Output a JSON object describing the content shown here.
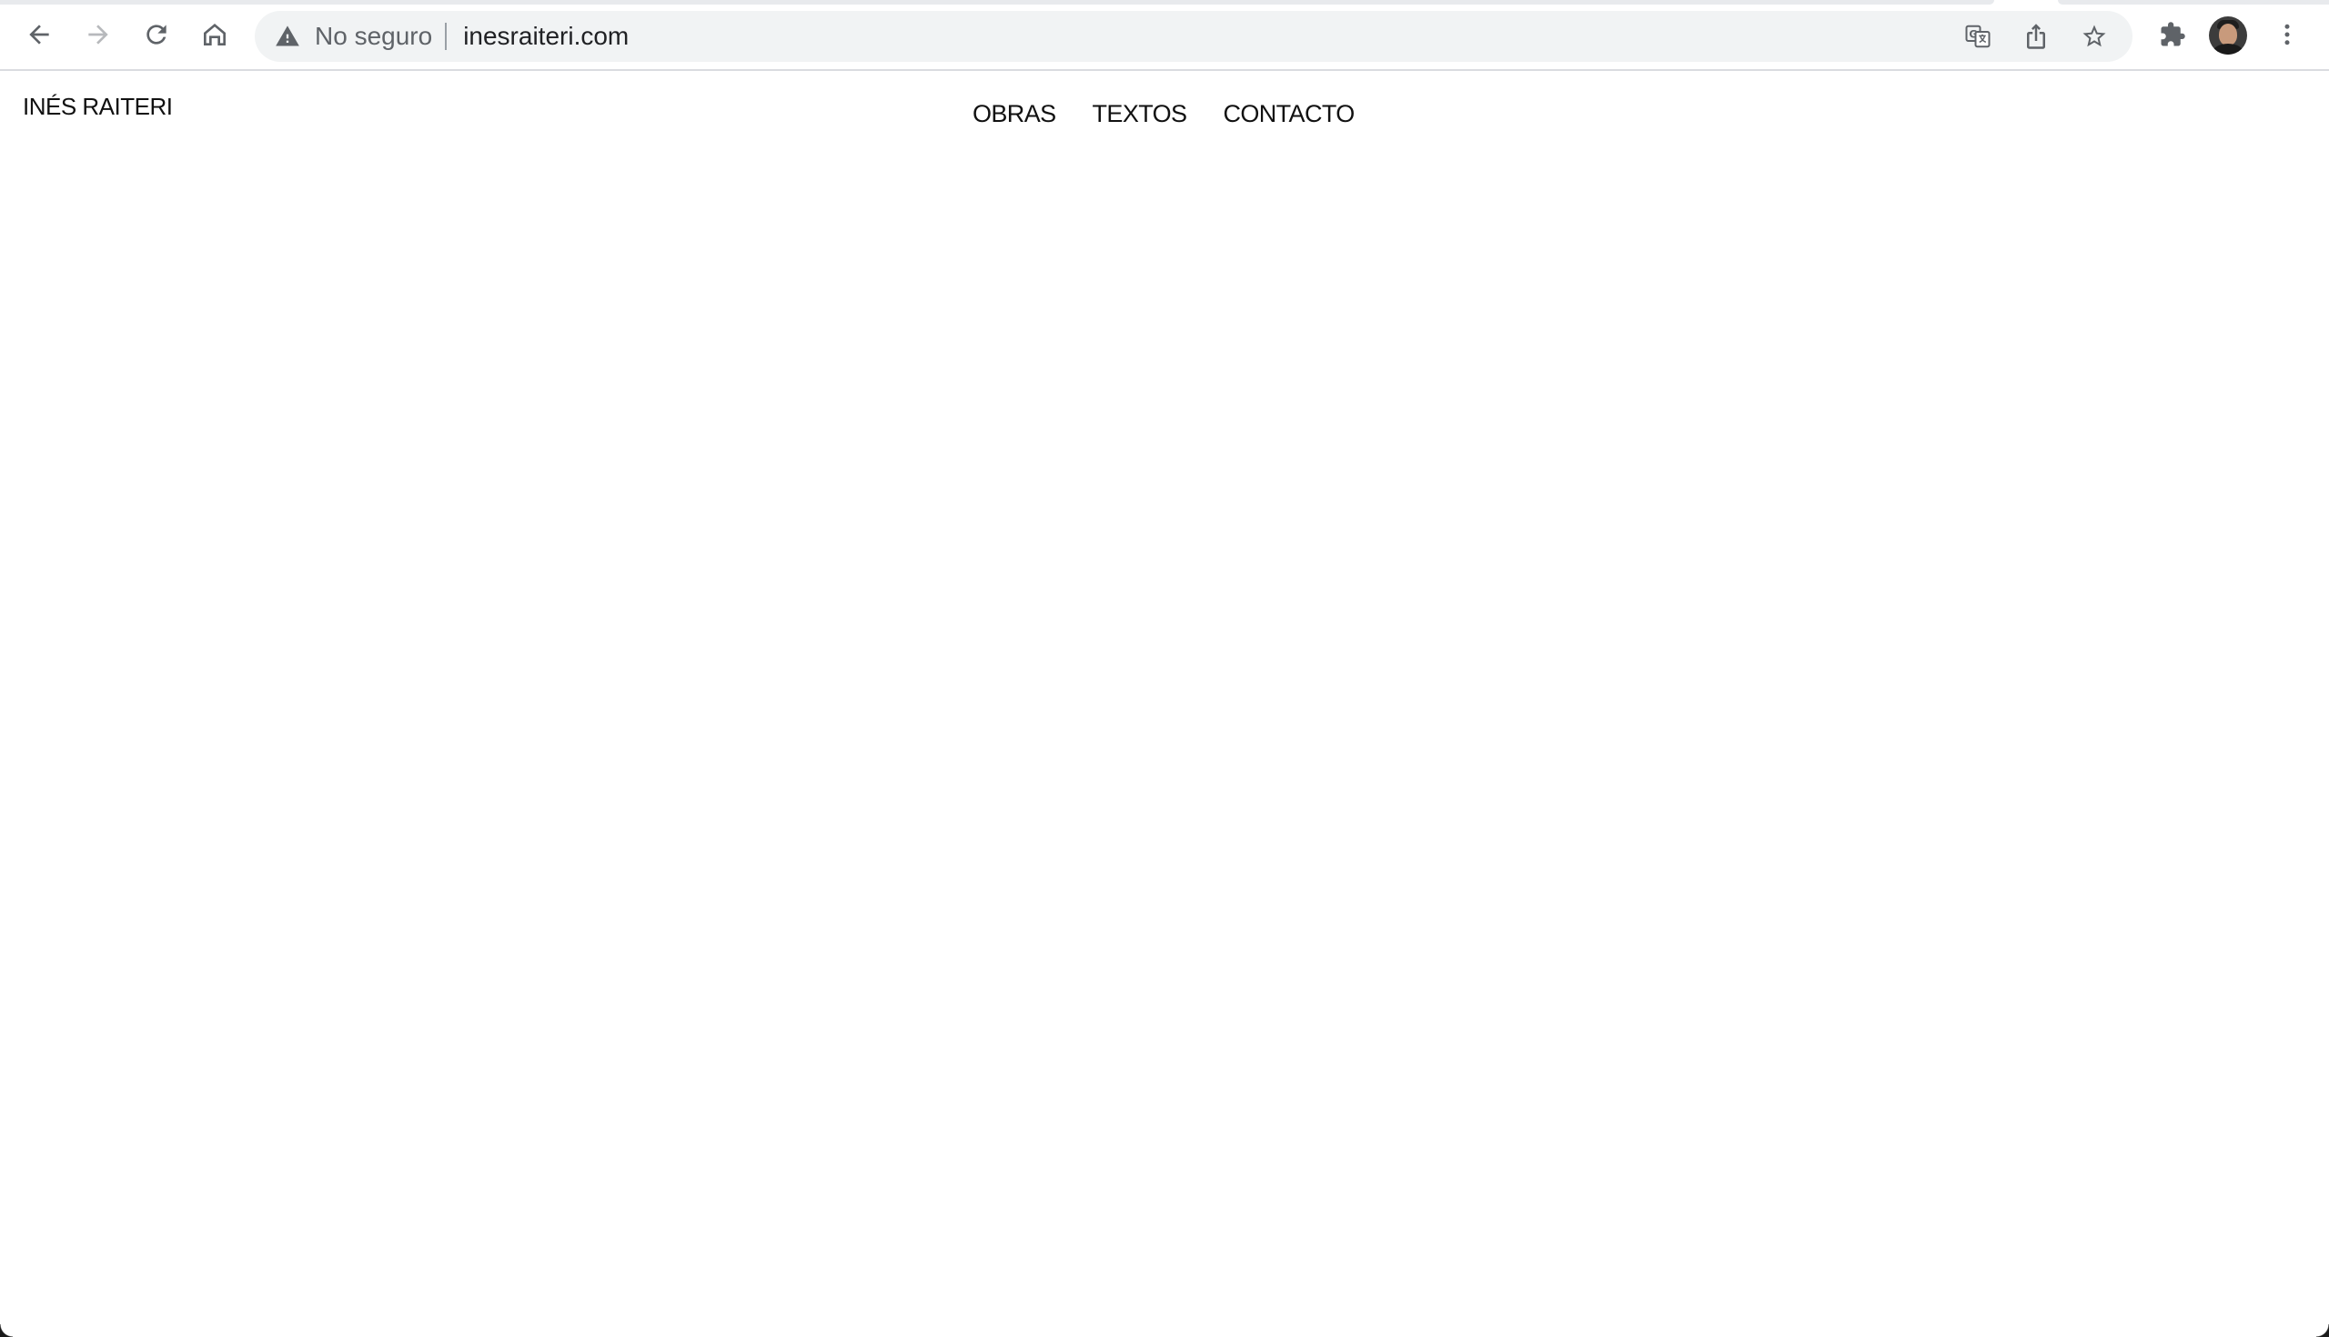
{
  "browser": {
    "security_label": "No seguro",
    "url": "inesraiteri.com",
    "icons": {
      "back": "arrow-left-icon",
      "forward": "arrow-right-icon",
      "reload": "reload-icon",
      "home": "home-icon",
      "security": "warning-triangle-icon",
      "translate": "translate-icon",
      "share": "share-icon",
      "bookmark": "star-icon",
      "extensions": "puzzle-icon",
      "menu": "kebab-menu-icon"
    },
    "colors": {
      "icon": "#5f6368",
      "icon_disabled": "#b7b9bc",
      "omnibox_bg": "#f1f3f4",
      "url_text": "#202124"
    }
  },
  "site": {
    "title": "INÉS RAITERI",
    "nav": [
      {
        "label": "OBRAS"
      },
      {
        "label": "TEXTOS"
      },
      {
        "label": "CONTACTO"
      }
    ],
    "colors": {
      "text": "#111111",
      "background": "#ffffff"
    }
  }
}
